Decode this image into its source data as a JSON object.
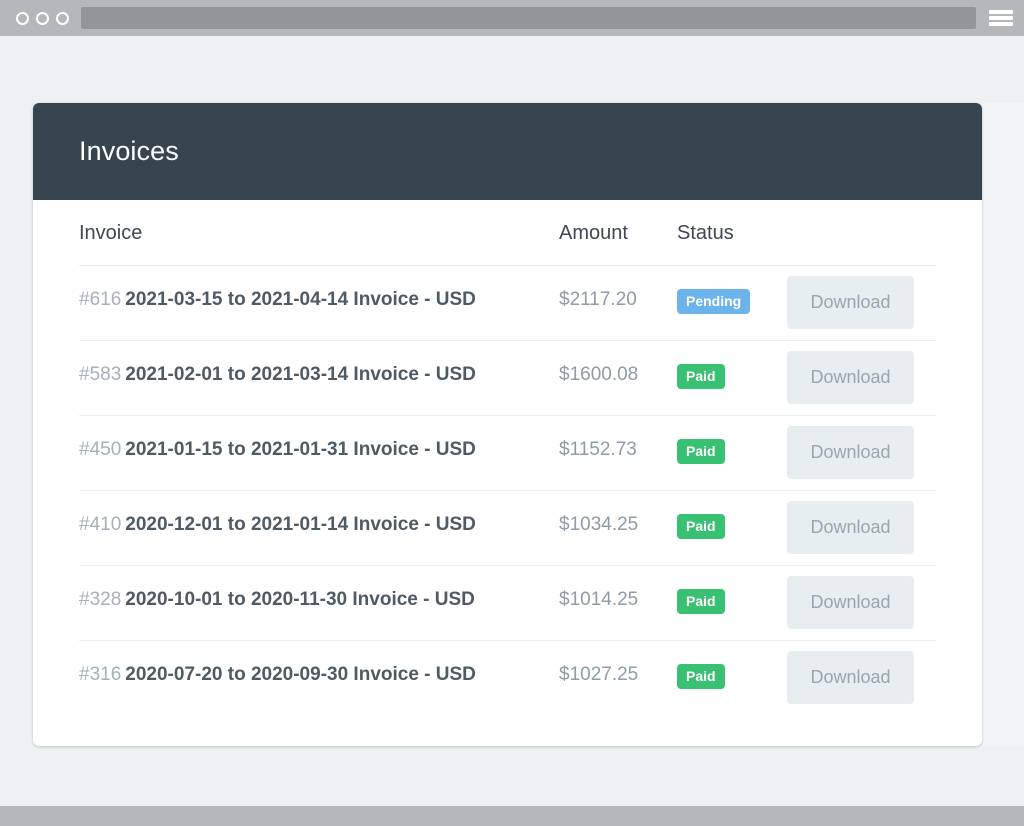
{
  "browser": {
    "traffic_lights": [
      "close",
      "minimize",
      "maximize"
    ],
    "url_value": "",
    "url_placeholder": "",
    "menu_icon": "hamburger-menu-icon"
  },
  "colors": {
    "header_bg": "#36454f",
    "page_bg": "#edf1f1",
    "gutter_bg": "#f3f4f6",
    "chrome_bg": "#b6b7b9",
    "badge_pending": "#6cb2eb",
    "badge_paid": "#38c172",
    "download_bg": "#e8edf0",
    "card_bg": "#ffffff"
  },
  "card": {
    "title": "Invoices"
  },
  "table": {
    "columns": [
      "Invoice",
      "Amount",
      "Status",
      ""
    ],
    "download_label": "Download",
    "rows": [
      {
        "number": "#616",
        "description": "2021-03-15 to 2021-04-14 Invoice - USD",
        "amount": "$2117.20",
        "status": "Pending",
        "status_kind": "pending",
        "action": "Download"
      },
      {
        "number": "#583",
        "description": "2021-02-01 to 2021-03-14 Invoice - USD",
        "amount": "$1600.08",
        "status": "Paid",
        "status_kind": "paid",
        "action": "Download"
      },
      {
        "number": "#450",
        "description": "2021-01-15 to 2021-01-31 Invoice - USD",
        "amount": "$1152.73",
        "status": "Paid",
        "status_kind": "paid",
        "action": "Download"
      },
      {
        "number": "#410",
        "description": "2020-12-01 to 2021-01-14 Invoice - USD",
        "amount": "$1034.25",
        "status": "Paid",
        "status_kind": "paid",
        "action": "Download"
      },
      {
        "number": "#328",
        "description": "2020-10-01 to 2020-11-30 Invoice - USD",
        "amount": "$1014.25",
        "status": "Paid",
        "status_kind": "paid",
        "action": "Download"
      },
      {
        "number": "#316",
        "description": "2020-07-20 to 2020-09-30 Invoice - USD",
        "amount": "$1027.25",
        "status": "Paid",
        "status_kind": "paid",
        "action": "Download"
      }
    ]
  }
}
